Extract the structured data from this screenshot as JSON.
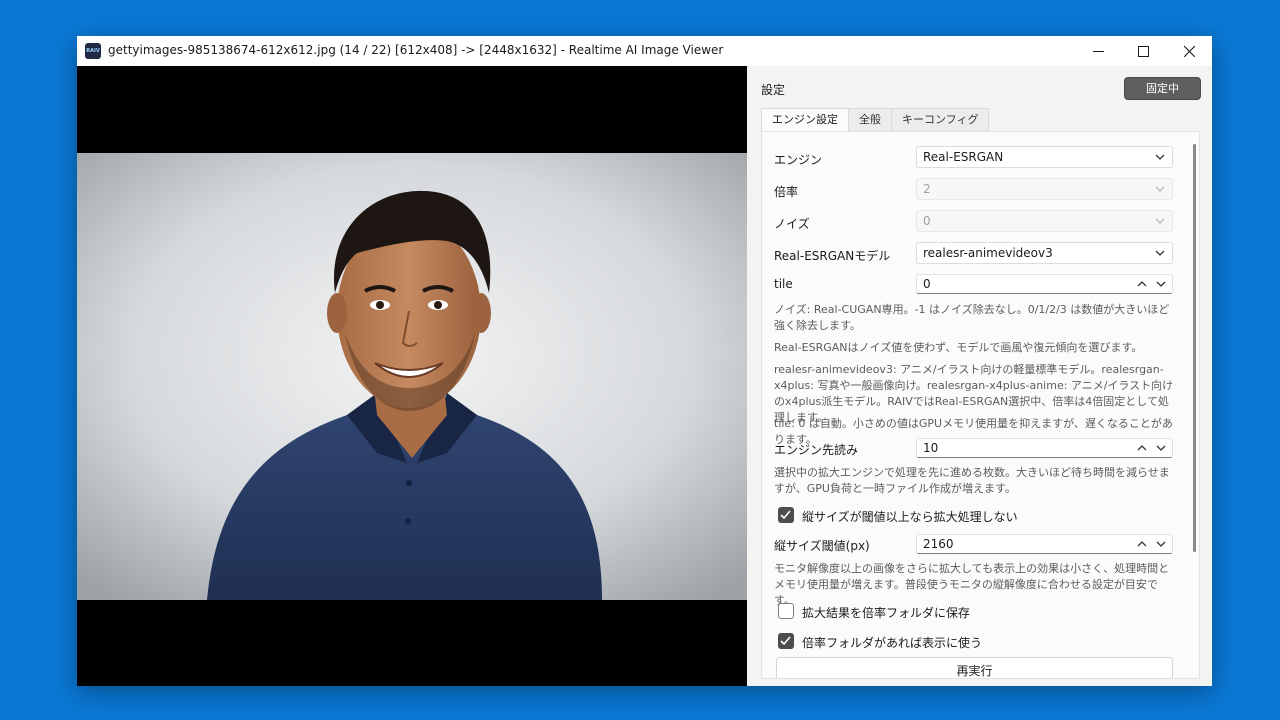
{
  "window": {
    "title": "gettyimages-985138674-612x612.jpg (14 / 22) [612x408] -> [2448x1632] - Realtime AI Image Viewer",
    "icon_text": "RAIV"
  },
  "panel": {
    "title": "設定",
    "lock_button": "固定中",
    "tabs": [
      "エンジン設定",
      "全般",
      "キーコンフィグ"
    ],
    "engine": {
      "label": "エンジン",
      "value": "Real-ESRGAN"
    },
    "scale": {
      "label": "倍率",
      "value": "2"
    },
    "noise": {
      "label": "ノイズ",
      "value": "0"
    },
    "model": {
      "label": "Real-ESRGANモデル",
      "value": "realesr-animevideov3"
    },
    "tile": {
      "label": "tile",
      "value": "0"
    },
    "help_noise": "ノイズ: Real-CUGAN専用。-1 はノイズ除去なし。0/1/2/3 は数値が大きいほど強く除去します。",
    "help_esrgan": "Real-ESRGANはノイズ値を使わず、モデルで画風や復元傾向を選びます。",
    "help_models": "realesr-animevideov3: アニメ/イラスト向けの軽量標準モデル。realesrgan-x4plus: 写真や一般画像向け。realesrgan-x4plus-anime: アニメ/イラスト向けのx4plus派生モデル。RAIVではReal-ESRGAN選択中、倍率は4倍固定として処理します。",
    "help_tile": "tile: 0 は自動。小さめの値はGPUメモリ使用量を抑えますが、遅くなることがあります。",
    "prefetch": {
      "label": "エンジン先読み",
      "value": "10"
    },
    "help_prefetch": "選択中の拡大エンジンで処理を先に進める枚数。大きいほど待ち時間を減らせますが、GPU負荷と一時ファイル作成が増えます。",
    "skip_threshold": {
      "label": "縦サイズが閾値以上なら拡大処理しない",
      "checked": true
    },
    "threshold": {
      "label": "縦サイズ閾値(px)",
      "value": "2160"
    },
    "help_threshold": "モニタ解像度以上の画像をさらに拡大しても表示上の効果は小さく、処理時間とメモリ使用量が増えます。普段使うモニタの縦解像度に合わせる設定が目安です。",
    "save_to_folder": {
      "label": "拡大結果を倍率フォルダに保存",
      "checked": false
    },
    "use_folder": {
      "label": "倍率フォルダがあれば表示に使う",
      "checked": true
    },
    "rerun_button": "再実行"
  },
  "icons": [
    "app-icon",
    "minimize-icon",
    "maximize-icon",
    "close-icon",
    "chevron-down-icon",
    "chevron-up-icon",
    "checkmark-icon"
  ],
  "colors": {
    "desktop": "#0a78d4",
    "lock_button": "#5f5f5f",
    "checkbox_on": "#4d4d4d"
  }
}
